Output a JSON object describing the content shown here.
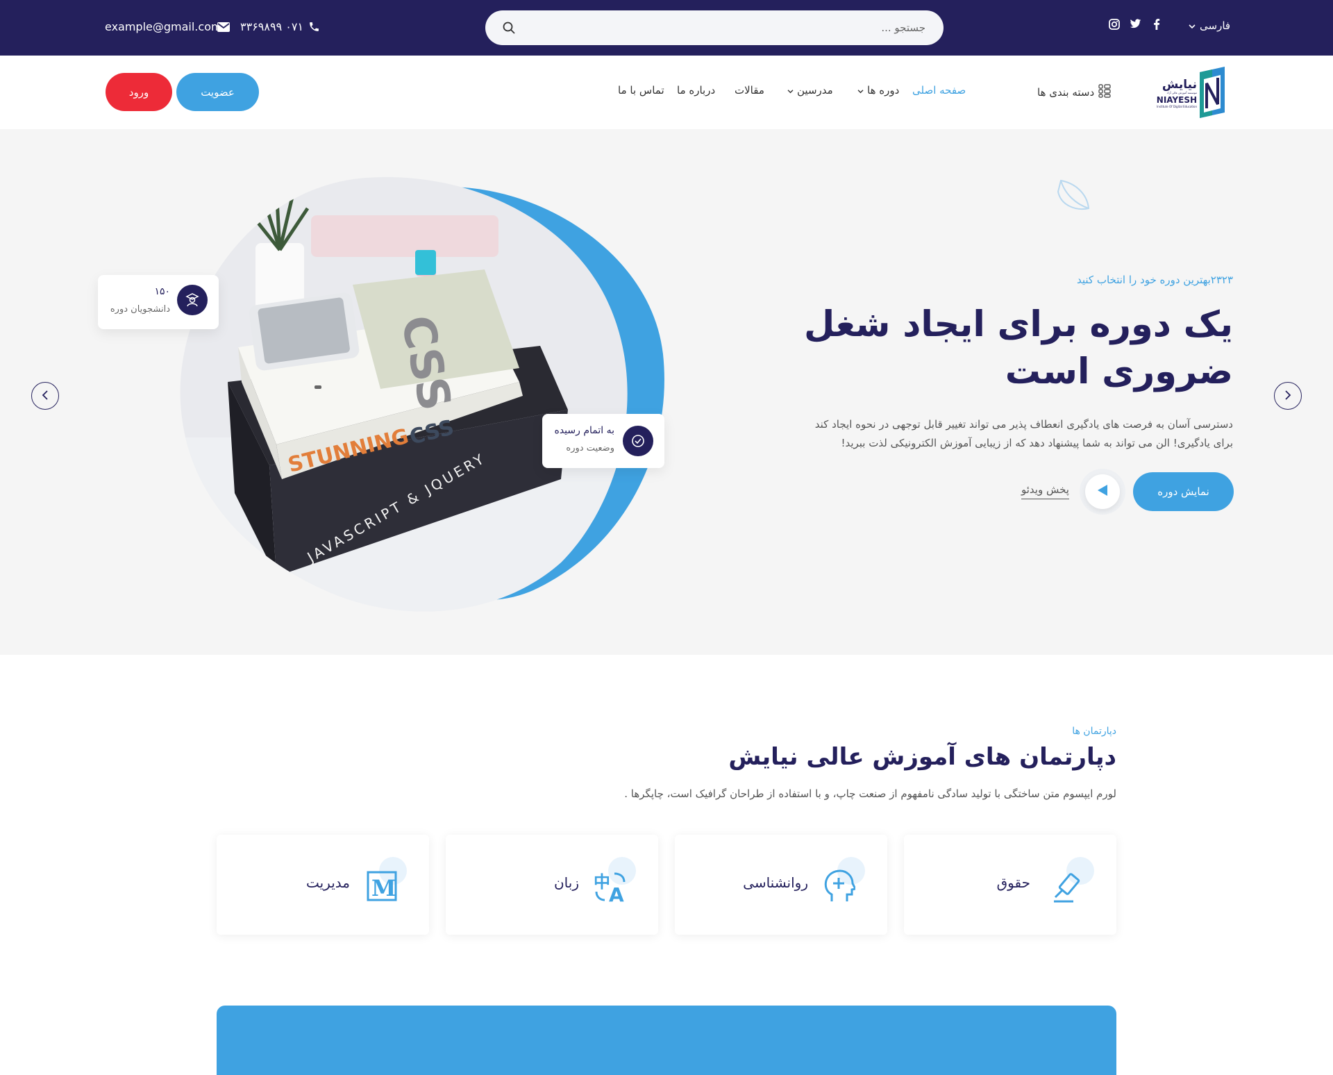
{
  "topbar": {
    "email": "example@gmail.com",
    "phone": "۰۷۱ ۳۳۶۹۸۹۹",
    "search_placeholder": "جستجو ...",
    "language": "فارسی"
  },
  "logo": {
    "name_fa": "نیایش",
    "name_en": "NIAYESH",
    "subtitle_fa": "موسسه آموزش عالی آزاد",
    "subtitle_en": "Institute Of Digital Education"
  },
  "nav": {
    "categories": "دسته بندی ها",
    "home": "صفحه اصلی",
    "courses": "دوره ها",
    "teachers": "مدرسین",
    "articles": "مقالات",
    "about": "درباره ما",
    "contact": "تماس با ما",
    "join": "عضویت",
    "login": "ورود"
  },
  "hero": {
    "tag": "۲۳۲۳بهترین دوره خود را انتخاب کنید",
    "title_line1": "یک دوره برای ایجاد شغل",
    "title_line2": "ضروری است",
    "desc_line1": "دسترسی آسان به فرصت های یادگیری انعطاف پذیر می تواند تغییر قابل توجهی در نحوه ایجاد کند",
    "desc_line2": "برای یادگیری! الن می تواند به شما پیشنهاد دهد که از زیبایی آموزش الکترونیکی لذت ببرید!",
    "show_course": "نمایش دوره",
    "play_video": "پخش ویدئو",
    "students_count": "۱۵۰",
    "students_label": "دانشجویان دوره",
    "status_value": "به اتمام رسیده",
    "status_label": "وضعیت دوره"
  },
  "departments": {
    "tag": "دپارتمان ها",
    "title": "دپارتمان های آموزش عالی نیایش",
    "desc": "لورم ایپسوم متن ساختگی با تولید سادگی نامفهوم از صنعت چاپ، و با استفاده از طراحان گرافیک است، چاپگرها .",
    "items": [
      {
        "label": "حقوق",
        "icon": "gavel-icon"
      },
      {
        "label": "روانشناسی",
        "icon": "head-plus-icon"
      },
      {
        "label": "زبان",
        "icon": "translate-icon"
      },
      {
        "label": "مدیریت",
        "icon": "m-letter-icon"
      }
    ]
  },
  "colors": {
    "navy": "#24205c",
    "accent": "#3fa2e1",
    "danger": "#ed2b38"
  }
}
